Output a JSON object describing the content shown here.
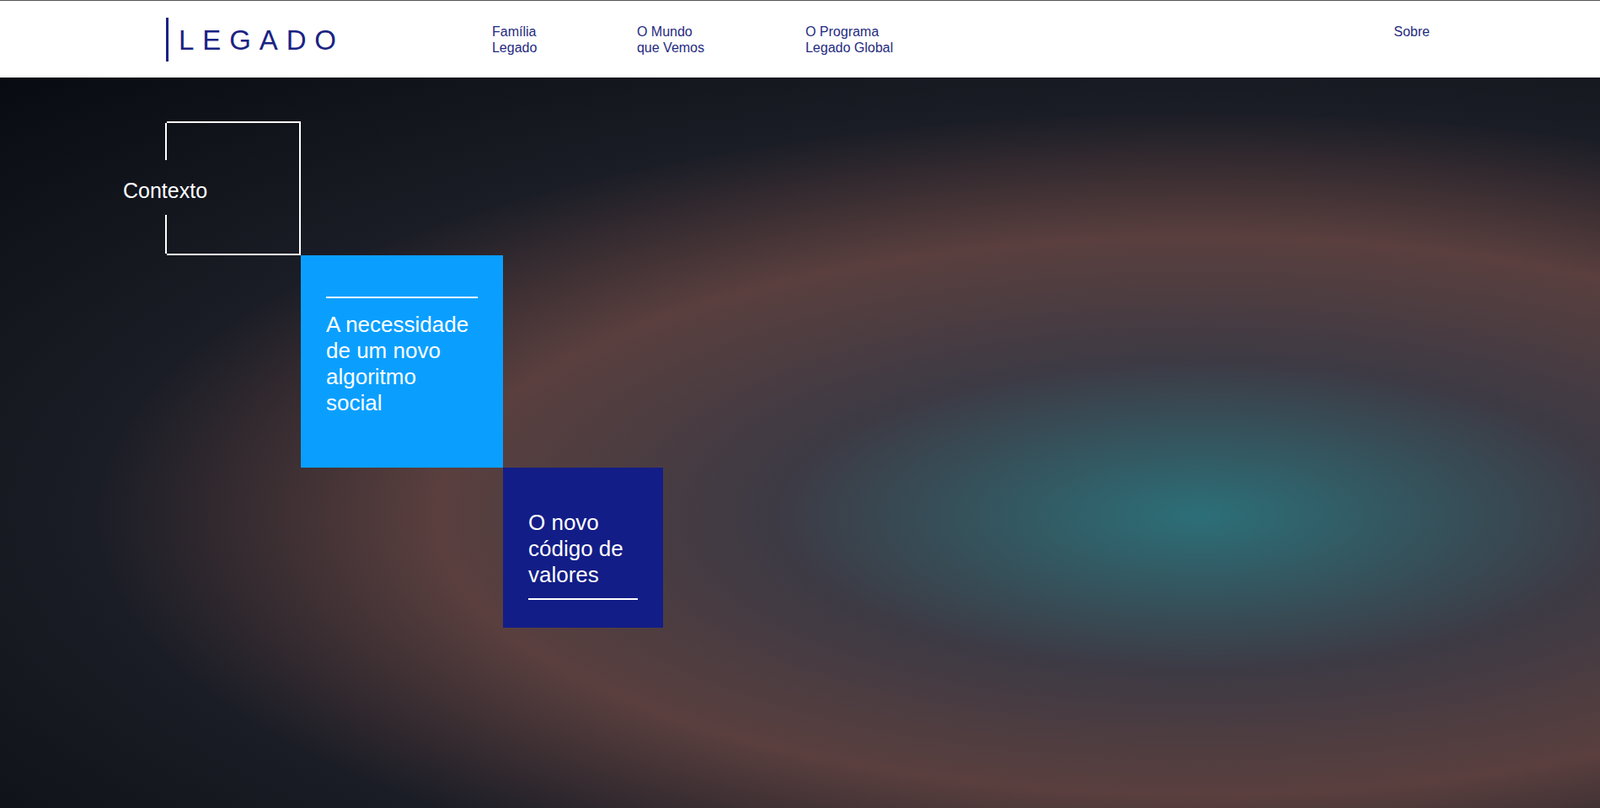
{
  "logo": {
    "text": "LEGADO"
  },
  "nav": {
    "items": [
      {
        "lines": [
          "Família",
          "Legado"
        ]
      },
      {
        "lines": [
          "O Mundo",
          "que Vemos"
        ]
      },
      {
        "lines": [
          "O Programa",
          "Legado Global"
        ]
      }
    ],
    "right": "Sobre"
  },
  "hero": {
    "section_label": "Contexto",
    "cards": [
      {
        "text": "A necessidade de um novo algoritmo social",
        "color": "#0a9fff"
      },
      {
        "text": "O novo código de valores",
        "color": "#131d87"
      }
    ]
  }
}
